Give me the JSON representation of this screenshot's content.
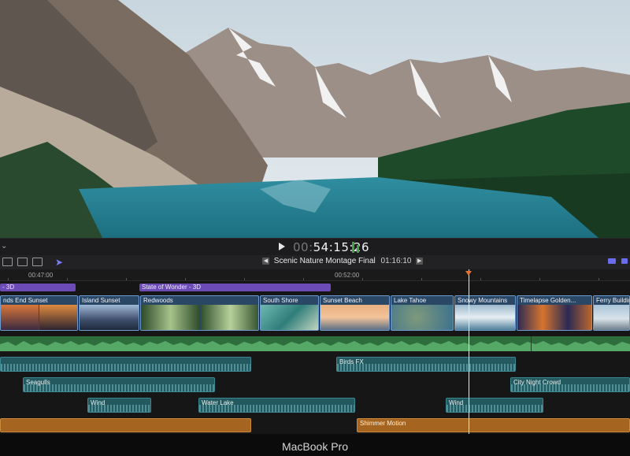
{
  "transport": {
    "timecode_dim": "00:",
    "timecode_bright": "54:15:26"
  },
  "project": {
    "name": "Scenic Nature Montage Final",
    "duration": "01:16:10",
    "prev_icon": "chevron-left-icon",
    "next_icon": "chevron-right-icon"
  },
  "ruler": {
    "marks": [
      "00:47:00",
      "00:52:00"
    ]
  },
  "titles": [
    {
      "label": "- 3D"
    },
    {
      "label": "State of Wonder - 3D"
    }
  ],
  "clips": [
    {
      "label": "nds End Sunset"
    },
    {
      "label": "Island Sunset"
    },
    {
      "label": "Redwoods"
    },
    {
      "label": "South Shore"
    },
    {
      "label": "Sunset Beach"
    },
    {
      "label": "Lake Tahoe"
    },
    {
      "label": "Snowy Mountains"
    },
    {
      "label": "Timelapse Golden..."
    },
    {
      "label": "Ferry Building"
    }
  ],
  "audio_clips": [
    {
      "label": ""
    },
    {
      "label": "Birds FX"
    },
    {
      "label": "Seagulls"
    },
    {
      "label": "City Night Crowd"
    },
    {
      "label": "Wind"
    },
    {
      "label": "Water Lake"
    },
    {
      "label": "Wind"
    }
  ],
  "music_clips": [
    {
      "label": ""
    },
    {
      "label": "Shimmer Motion"
    }
  ],
  "device_label": "MacBook Pro",
  "colors": {
    "title_purple": "#6c4bb6",
    "clip_blue": "#2a4766",
    "audio_green": "#2e6e3c",
    "audio_teal": "#23595f",
    "music_orange": "#a5641f",
    "playhead_orange": "#e37236"
  }
}
